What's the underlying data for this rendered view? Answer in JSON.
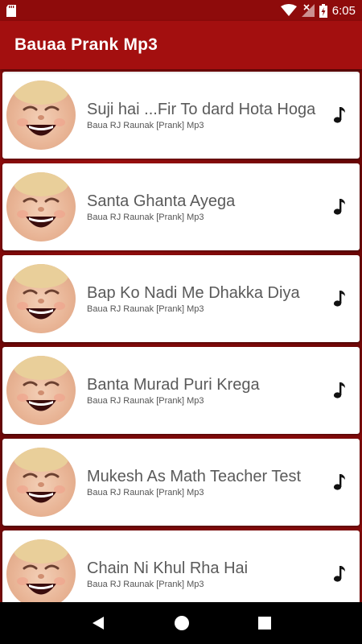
{
  "status_bar": {
    "time": "6:05",
    "icons": [
      "sd-card-icon",
      "wifi-icon",
      "signal-icon",
      "battery-charging-icon"
    ]
  },
  "app_bar": {
    "title": "Bauaa Prank Mp3",
    "color": "#a30f0f"
  },
  "tracks": [
    {
      "title": "Suji hai ...Fir To dard Hota Hoga",
      "subtitle": "Baua RJ Raunak [Prank] Mp3",
      "icon": "music-note-icon"
    },
    {
      "title": "Santa Ghanta Ayega",
      "subtitle": "Baua RJ Raunak [Prank] Mp3",
      "icon": "music-note-icon"
    },
    {
      "title": "Bap Ko Nadi Me Dhakka Diya",
      "subtitle": "Baua RJ Raunak [Prank] Mp3",
      "icon": "music-note-icon"
    },
    {
      "title": "Banta Murad Puri Krega",
      "subtitle": "Baua RJ Raunak [Prank] Mp3",
      "icon": "music-note-icon"
    },
    {
      "title": "Mukesh As Math Teacher Test",
      "subtitle": "Baua RJ Raunak [Prank] Mp3",
      "icon": "music-note-icon"
    },
    {
      "title": "Chain Ni Khul Rha Hai",
      "subtitle": "Baua RJ Raunak [Prank] Mp3",
      "icon": "music-note-icon"
    }
  ],
  "nav_bar": {
    "buttons": [
      "back-icon",
      "home-icon",
      "recents-icon"
    ]
  }
}
